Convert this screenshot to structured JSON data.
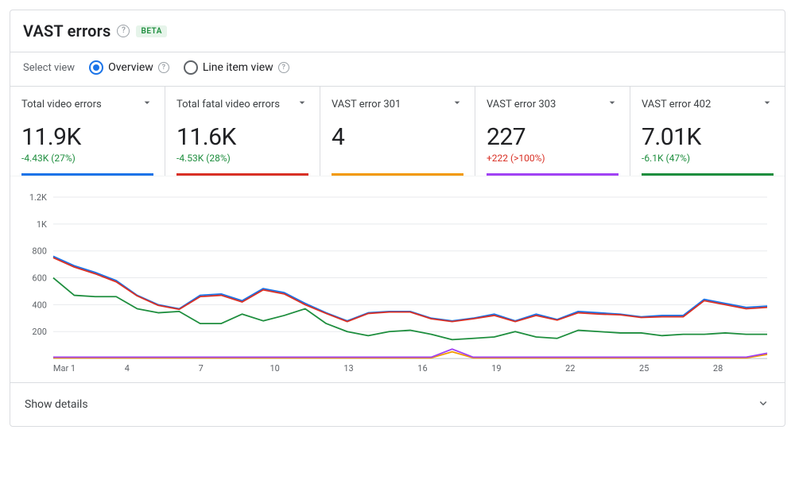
{
  "header": {
    "title": "VAST errors",
    "badge": "BETA"
  },
  "views": {
    "label": "Select view",
    "options": [
      {
        "label": "Overview",
        "selected": true
      },
      {
        "label": "Line item view",
        "selected": false
      }
    ]
  },
  "cards": [
    {
      "title": "Total video errors",
      "value": "11.9K",
      "delta": "-4.43K (27%)",
      "delta_sign": "neg",
      "color": "#1a73e8"
    },
    {
      "title": "Total fatal video errors",
      "value": "11.6K",
      "delta": "-4.53K (28%)",
      "delta_sign": "neg",
      "color": "#d93025"
    },
    {
      "title": "VAST error 301",
      "value": "4",
      "delta": "",
      "delta_sign": "",
      "color": "#f29900"
    },
    {
      "title": "VAST error 303",
      "value": "227",
      "delta": "+222 (>100%)",
      "delta_sign": "pos",
      "color": "#a142f4"
    },
    {
      "title": "VAST error 402",
      "value": "7.01K",
      "delta": "-6.1K (47%)",
      "delta_sign": "neg",
      "color": "#1e8e3e"
    }
  ],
  "details": {
    "label": "Show details"
  },
  "chart_data": {
    "type": "line",
    "xlabel": "",
    "ylabel": "",
    "ylim": [
      0,
      1200
    ],
    "yticks": [
      200,
      400,
      600,
      800,
      1000,
      1200
    ],
    "ytick_labels": [
      "200",
      "400",
      "600",
      "800",
      "1K",
      "1.2K"
    ],
    "x": [
      1,
      2,
      3,
      4,
      5,
      6,
      7,
      8,
      9,
      10,
      11,
      12,
      13,
      14,
      15,
      16,
      17,
      18,
      19,
      20,
      21,
      22,
      23,
      24,
      25,
      26,
      27,
      28,
      29,
      30
    ],
    "x_tick_positions": [
      1,
      4,
      7,
      10,
      13,
      16,
      19,
      22,
      25,
      28
    ],
    "x_tick_labels": [
      "Mar 1",
      "4",
      "7",
      "10",
      "13",
      "16",
      "19",
      "22",
      "25",
      "28"
    ],
    "series": [
      {
        "name": "Total video errors",
        "color": "#1a73e8",
        "values": [
          760,
          690,
          640,
          580,
          470,
          400,
          370,
          470,
          480,
          430,
          520,
          490,
          410,
          340,
          280,
          340,
          350,
          350,
          300,
          280,
          300,
          330,
          280,
          330,
          290,
          350,
          340,
          330,
          310,
          320,
          320,
          440,
          410,
          380,
          390
        ]
      },
      {
        "name": "Total fatal video errors",
        "color": "#d93025",
        "values": [
          750,
          680,
          630,
          570,
          465,
          395,
          365,
          460,
          470,
          420,
          510,
          480,
          400,
          335,
          275,
          335,
          345,
          345,
          295,
          275,
          295,
          320,
          275,
          320,
          285,
          340,
          330,
          325,
          305,
          310,
          310,
          430,
          400,
          370,
          380
        ]
      },
      {
        "name": "VAST error 301",
        "color": "#f29900",
        "values": [
          5,
          5,
          5,
          5,
          5,
          5,
          5,
          5,
          5,
          5,
          5,
          5,
          5,
          5,
          5,
          5,
          5,
          5,
          5,
          50,
          5,
          5,
          5,
          5,
          5,
          5,
          5,
          5,
          5,
          5,
          5,
          5,
          5,
          5,
          30
        ]
      },
      {
        "name": "VAST error 303",
        "color": "#a142f4",
        "values": [
          10,
          10,
          10,
          10,
          10,
          10,
          10,
          10,
          10,
          10,
          10,
          10,
          10,
          10,
          10,
          10,
          10,
          10,
          10,
          70,
          10,
          10,
          10,
          10,
          10,
          10,
          10,
          10,
          10,
          10,
          10,
          10,
          10,
          10,
          40
        ]
      },
      {
        "name": "VAST error 402",
        "color": "#1e8e3e",
        "values": [
          600,
          470,
          460,
          460,
          370,
          340,
          350,
          260,
          260,
          330,
          280,
          320,
          370,
          260,
          200,
          170,
          200,
          210,
          180,
          140,
          150,
          160,
          200,
          160,
          150,
          210,
          200,
          190,
          190,
          170,
          180,
          180,
          190,
          180,
          180
        ]
      }
    ]
  }
}
